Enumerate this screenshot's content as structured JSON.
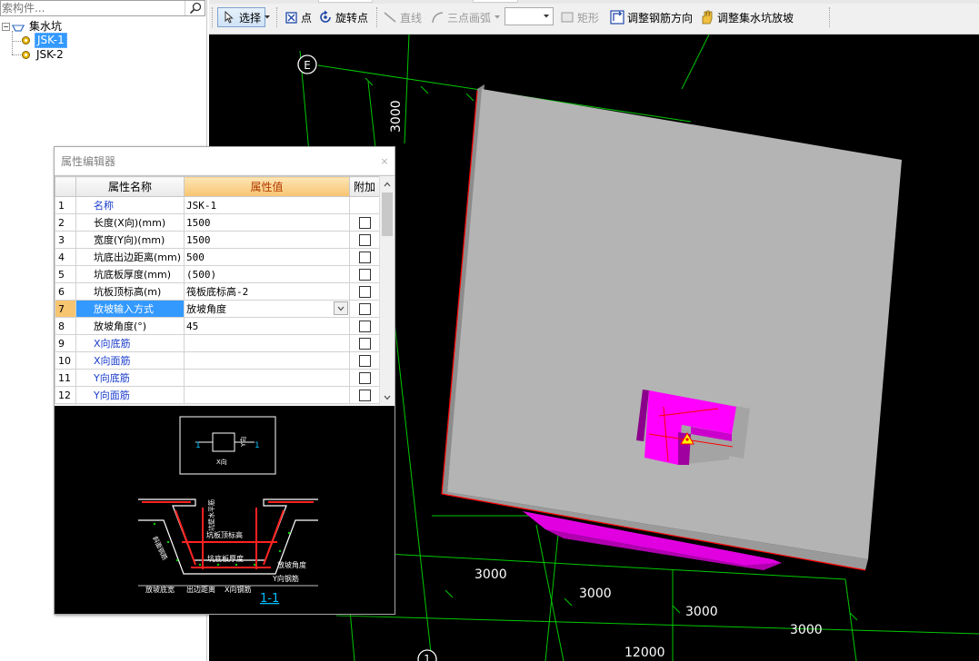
{
  "tree": {
    "search_placeholder": "索构件...",
    "root_label": "集水坑",
    "items": [
      {
        "label": "JSK-1",
        "selected": true
      },
      {
        "label": "JSK-2",
        "selected": false
      }
    ]
  },
  "toolbar": {
    "select_label": "选择",
    "point_label": "点",
    "rotate_point_label": "旋转点",
    "line_label": "直线",
    "arc_label": "三点画弧",
    "dropdown_value": "",
    "rect_label": "矩形",
    "adjust_rebar_label": "调整钢筋方向",
    "adjust_slope_label": "调整集水坑放坡"
  },
  "canvas": {
    "axis_label_e": "E",
    "axis_label_1": "1",
    "dims_horizontal": [
      "3000",
      "3000",
      "3000",
      "3000"
    ],
    "dim_total": "12000",
    "dim_vertical": "3000"
  },
  "property_editor": {
    "title": "属性编辑器",
    "close_label": "×",
    "headers": {
      "name": "属性名称",
      "value": "属性值",
      "extra": "附加"
    },
    "rows": [
      {
        "num": "1",
        "name": "名称",
        "value": "JSK-1",
        "blue": true,
        "check": false
      },
      {
        "num": "2",
        "name": "长度(X向)(mm)",
        "value": "1500",
        "blue": false,
        "check": true
      },
      {
        "num": "3",
        "name": "宽度(Y向)(mm)",
        "value": "1500",
        "blue": false,
        "check": true
      },
      {
        "num": "4",
        "name": "坑底出边距离(mm)",
        "value": "500",
        "blue": false,
        "check": true
      },
      {
        "num": "5",
        "name": "坑底板厚度(mm)",
        "value": "(500)",
        "blue": false,
        "check": true
      },
      {
        "num": "6",
        "name": "坑板顶标高(m)",
        "value": "筏板底标高-2",
        "blue": false,
        "check": true
      },
      {
        "num": "7",
        "name": "放坡输入方式",
        "value": "放坡角度",
        "blue": false,
        "check": true,
        "current": true,
        "combo": true
      },
      {
        "num": "8",
        "name": "放坡角度(°)",
        "value": "45",
        "blue": false,
        "check": true
      },
      {
        "num": "9",
        "name": "X向底筋",
        "value": "",
        "blue": true,
        "check": true
      },
      {
        "num": "10",
        "name": "X向面筋",
        "value": "",
        "blue": true,
        "check": true
      },
      {
        "num": "11",
        "name": "Y向底筋",
        "value": "",
        "blue": true,
        "check": true
      },
      {
        "num": "12",
        "name": "Y向面筋",
        "value": "",
        "blue": true,
        "check": true
      }
    ],
    "preview": {
      "section_label": "1-1",
      "label_1_left": "1",
      "label_1_right": "1",
      "label_x": "X向",
      "label_y": "Y向",
      "label_top_elev": "坑板顶标高",
      "label_bottom_thickness": "坑底板厚度",
      "label_slope_angle": "放坡角度",
      "label_y_rebar": "Y向钢筋",
      "label_slope_width": "放坡底宽",
      "label_out_distance": "出边距离",
      "label_x_rebar": "X向钢筋",
      "label_horizontal_rebar": "坑壁水平筋",
      "label_slope_rebar": "斜面钢筋"
    }
  },
  "colors": {
    "canvas_bg": "#000000",
    "slab_gray": "#b4b4b4",
    "pit_magenta": "#ff00ff",
    "grid_green": "#00c800",
    "edge_red": "#ff0000"
  }
}
